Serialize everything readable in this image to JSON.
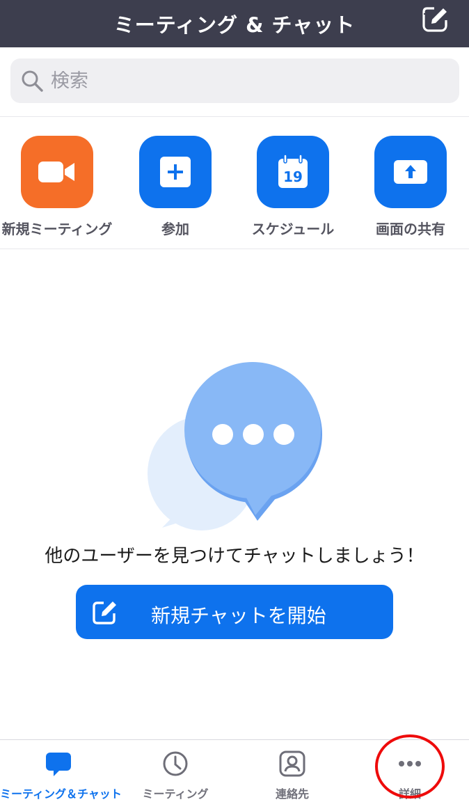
{
  "header": {
    "title": "ミーティング & チャット",
    "compose_icon": "compose-icon"
  },
  "search": {
    "placeholder": "検索",
    "icon": "search-icon"
  },
  "quick_actions": [
    {
      "label": "新規ミーティング",
      "icon": "video-camera-icon",
      "color": "#f56e28"
    },
    {
      "label": "参加",
      "icon": "plus-icon",
      "color": "#0e72ed"
    },
    {
      "label": "スケジュール",
      "icon": "calendar-icon",
      "calendar_day": "19",
      "color": "#0e72ed"
    },
    {
      "label": "画面の共有",
      "icon": "share-screen-icon",
      "color": "#0e72ed"
    }
  ],
  "empty_state": {
    "message": "他のユーザーを見つけてチャットしましょう！",
    "icon": "chat-bubbles-icon",
    "button_label": "新規チャットを開始",
    "button_icon": "compose-icon"
  },
  "tabbar": {
    "tabs": [
      {
        "label": "ミーティング＆チャット",
        "icon": "chat-icon",
        "active": true
      },
      {
        "label": "ミーティング",
        "icon": "clock-icon",
        "active": false
      },
      {
        "label": "連絡先",
        "icon": "contacts-icon",
        "active": false
      },
      {
        "label": "詳細",
        "icon": "more-icon",
        "active": false
      }
    ]
  },
  "colors": {
    "header_bg": "#3d3e4e",
    "accent": "#0e72ed",
    "orange": "#f56e28",
    "highlight": "#ee0b0b"
  }
}
